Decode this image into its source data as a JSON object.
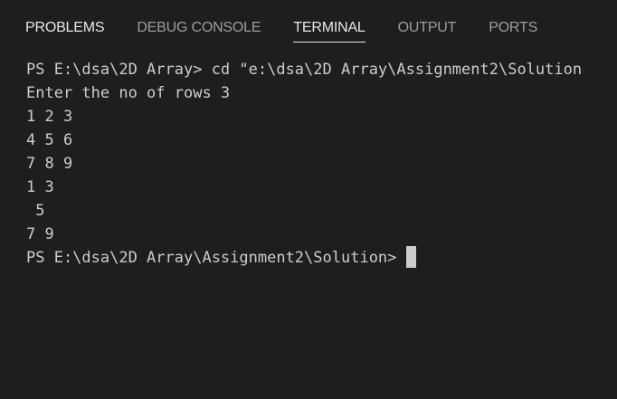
{
  "panel": {
    "tabs": [
      {
        "label": "PROBLEMS"
      },
      {
        "label": "DEBUG CONSOLE"
      },
      {
        "label": "TERMINAL"
      },
      {
        "label": "OUTPUT"
      },
      {
        "label": "PORTS"
      }
    ],
    "active_tab": "TERMINAL"
  },
  "terminal": {
    "lines": [
      "PS E:\\dsa\\2D Array> cd \"e:\\dsa\\2D Array\\Assignment2\\Solution",
      "Enter the no of rows 3",
      "1 2 3",
      "4 5 6",
      "7 8 9",
      "1 3",
      " 5",
      "7 9"
    ],
    "prompt": "PS E:\\dsa\\2D Array\\Assignment2\\Solution> "
  },
  "colors": {
    "background": "#1e1e1e",
    "text": "#cccccc",
    "tab_inactive": "#9d9d9d",
    "tab_active": "#e7e7e7"
  }
}
